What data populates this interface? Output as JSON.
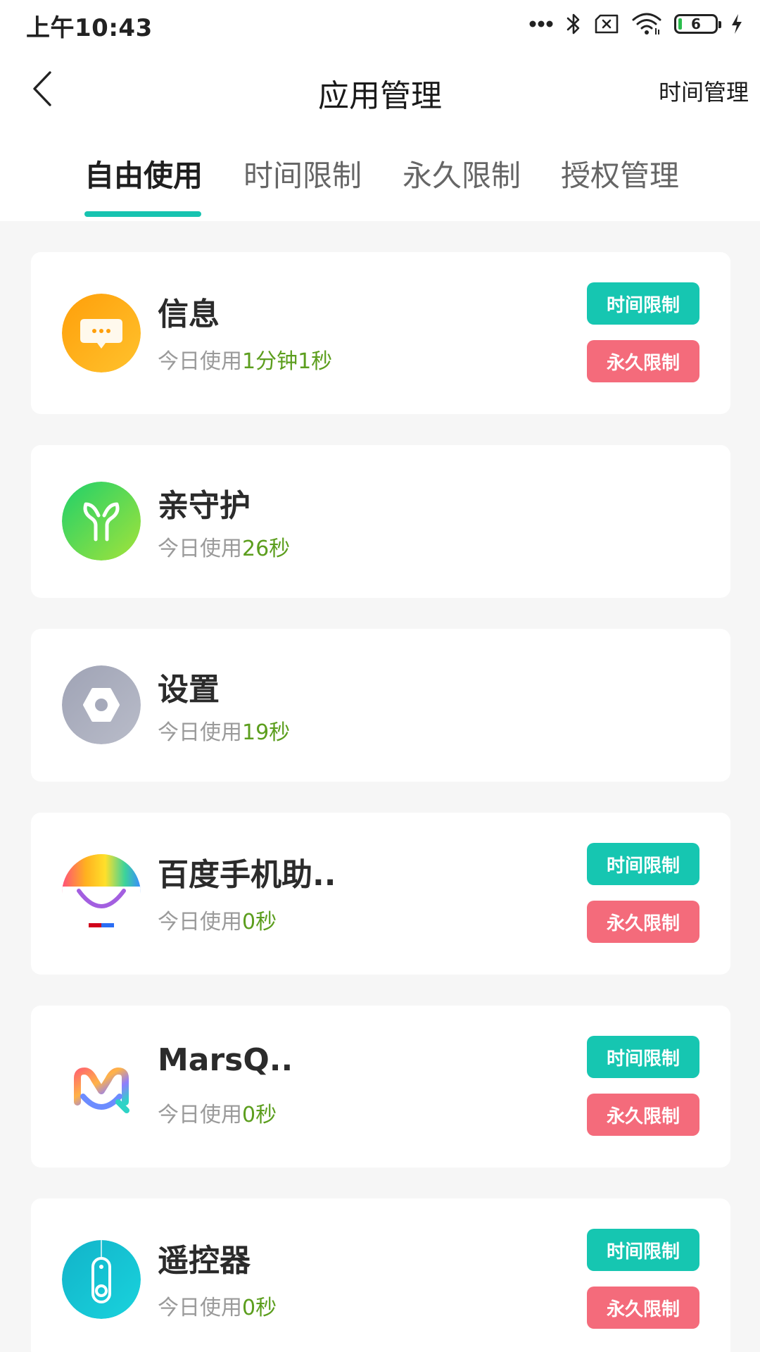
{
  "status_bar": {
    "time": "上午10:43",
    "battery_level": "6",
    "icons": [
      "more-dots-icon",
      "bluetooth-icon",
      "sim-card-x-icon",
      "wifi-icon",
      "battery-icon",
      "charging-bolt-icon"
    ]
  },
  "header": {
    "title": "应用管理",
    "right_action": "时间管理",
    "back_icon": "back-arrow-icon"
  },
  "tabs": [
    {
      "label": "自由使用",
      "active": true
    },
    {
      "label": "时间限制",
      "active": false
    },
    {
      "label": "永久限制",
      "active": false
    },
    {
      "label": "授权管理",
      "active": false
    }
  ],
  "colors": {
    "accent": "#16c6b1",
    "danger": "#f46b7b",
    "usage_value": "#5c9e1e"
  },
  "apps": [
    {
      "name": "信息",
      "usage_label": "今日使用",
      "usage_value": "1分钟1秒",
      "icon": "messages-icon",
      "time_limit_btn": "时间限制",
      "perm_limit_btn": "永久限制"
    },
    {
      "name": "亲守护",
      "usage_label": "今日使用",
      "usage_value": "26秒",
      "icon": "qinshouhu-icon"
    },
    {
      "name": "设置",
      "usage_label": "今日使用",
      "usage_value": "19秒",
      "icon": "settings-icon"
    },
    {
      "name": "百度手机助..",
      "usage_label": "今日使用",
      "usage_value": "0秒",
      "icon": "baidu-assistant-icon",
      "time_limit_btn": "时间限制",
      "perm_limit_btn": "永久限制"
    },
    {
      "name": "MarsQ..",
      "usage_label": "今日使用",
      "usage_value": "0秒",
      "icon": "marsq-icon",
      "time_limit_btn": "时间限制",
      "perm_limit_btn": "永久限制"
    },
    {
      "name": "遥控器",
      "usage_label": "今日使用",
      "usage_value": "0秒",
      "icon": "remote-control-icon",
      "time_limit_btn": "时间限制",
      "perm_limit_btn": "永久限制"
    }
  ]
}
